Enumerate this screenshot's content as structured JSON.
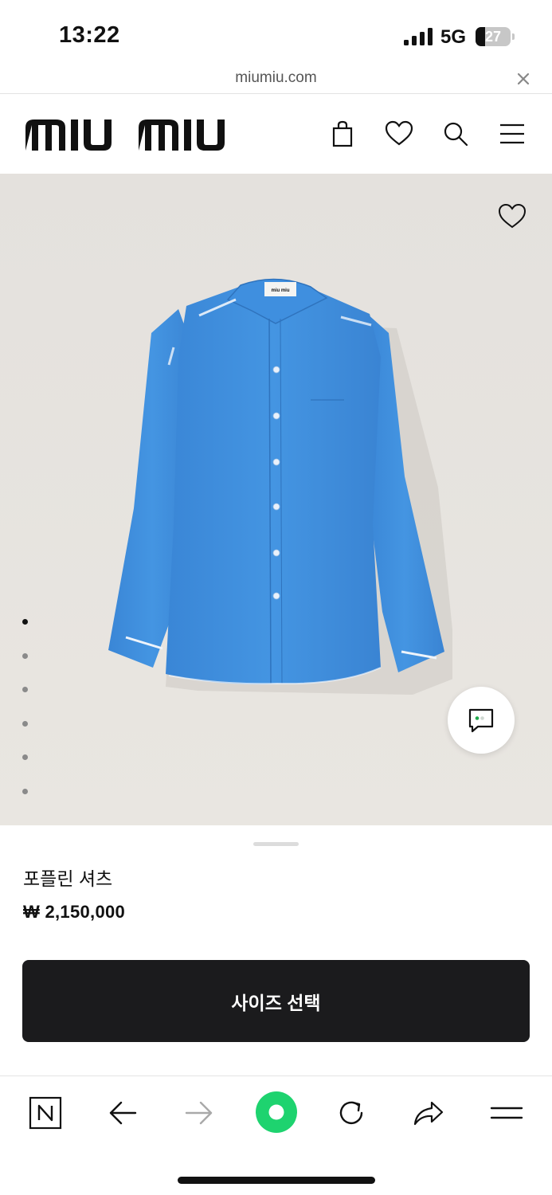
{
  "status_bar": {
    "time": "13:22",
    "network": "5G",
    "battery_level": "27",
    "battery_fraction": 0.27
  },
  "url_bar": {
    "domain": "miumiu.com",
    "close_icon": "close-icon"
  },
  "header": {
    "logo_text": "miu miu",
    "icons": [
      "shopping-bag-icon",
      "heart-icon",
      "search-icon",
      "menu-icon"
    ]
  },
  "gallery": {
    "image": "blue poplin shirt",
    "wishlist_icon": "heart-icon",
    "dot_count": 6,
    "active_index": 0,
    "chat_icon": "chat-icon"
  },
  "product": {
    "name": "포플린 셔츠",
    "price": "₩ 2,150,000",
    "size_button": "사이즈 선택"
  },
  "browser_bar": {
    "icons": [
      "naver-n-icon",
      "back-arrow-icon",
      "forward-arrow-icon",
      "green-dot-icon",
      "reload-icon",
      "share-icon",
      "hamburger-icon"
    ]
  },
  "colors": {
    "accent_green": "#1ed36f",
    "button_dark": "#1b1b1d",
    "shirt_blue": "#3d8ddc",
    "image_background": "#e6e3df"
  }
}
